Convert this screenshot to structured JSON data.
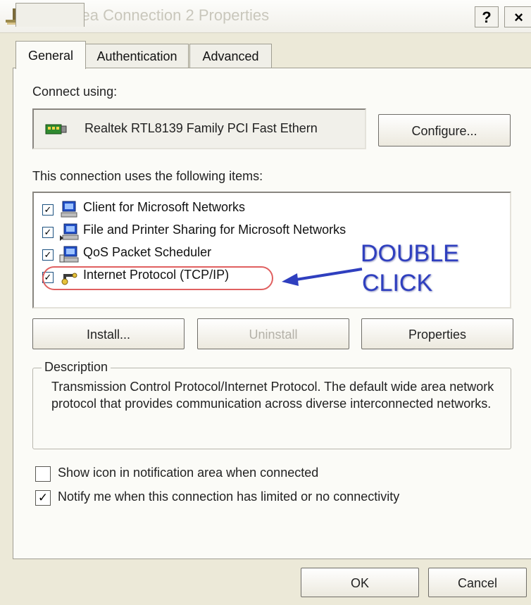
{
  "window": {
    "title": "Local Area Connection 2 Properties",
    "help_label": "?",
    "close_label": "×"
  },
  "tabs": [
    {
      "label": "General",
      "active": true
    },
    {
      "label": "Authentication",
      "active": false
    },
    {
      "label": "Advanced",
      "active": false
    }
  ],
  "connect_using": {
    "label": "Connect using:",
    "adapter": "Realtek RTL8139 Family PCI Fast Ethern",
    "adapter_icon": "network-card-icon",
    "configure_label": "Configure..."
  },
  "items": {
    "label": "This connection uses the following items:",
    "list": [
      {
        "label": "Client for Microsoft Networks",
        "checked": true,
        "icon": "network-client-icon"
      },
      {
        "label": "File and Printer Sharing for Microsoft Networks",
        "checked": true,
        "icon": "file-sharing-icon"
      },
      {
        "label": "QoS Packet Scheduler",
        "checked": true,
        "icon": "scheduler-icon"
      },
      {
        "label": "Internet Protocol (TCP/IP)",
        "checked": true,
        "icon": "protocol-icon"
      }
    ]
  },
  "annotation": {
    "line1": "DOUBLE",
    "line2": "CLICK",
    "color": "#2f3fbf",
    "highlight_color": "#e06060"
  },
  "buttons": {
    "install": "Install...",
    "uninstall": "Uninstall",
    "properties": "Properties",
    "ok": "OK",
    "cancel": "Cancel"
  },
  "description": {
    "legend": "Description",
    "text": "Transmission Control Protocol/Internet Protocol. The default wide area network protocol that provides communication across diverse interconnected networks."
  },
  "options": [
    {
      "label": "Show icon in notification area when connected",
      "checked": false
    },
    {
      "label": "Notify me when this connection has limited or no connectivity",
      "checked": true
    }
  ],
  "colors": {
    "dialog_bg": "#ece9d8",
    "panel_bg": "#fbfbf7",
    "title_text": "#c9c7bc"
  }
}
